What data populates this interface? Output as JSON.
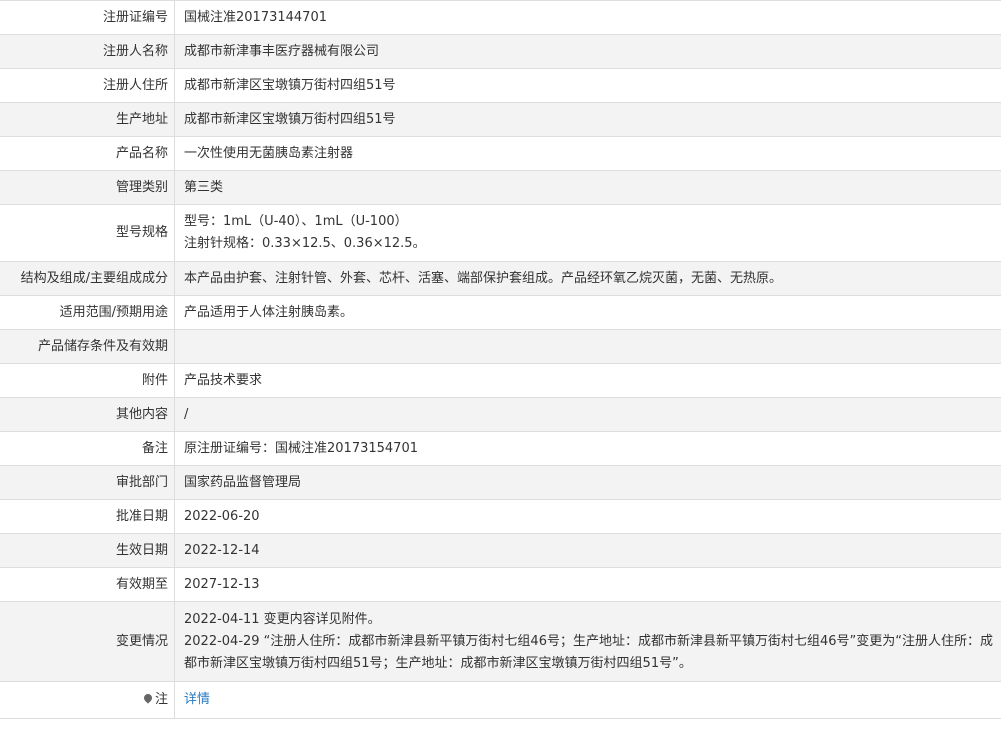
{
  "rows": [
    {
      "label": "注册证编号",
      "value": "国械注准20173144701"
    },
    {
      "label": "注册人名称",
      "value": "成都市新津事丰医疗器械有限公司"
    },
    {
      "label": "注册人住所",
      "value": "成都市新津区宝墩镇万街村四组51号"
    },
    {
      "label": "生产地址",
      "value": "成都市新津区宝墩镇万街村四组51号"
    },
    {
      "label": "产品名称",
      "value": "一次性使用无菌胰岛素注射器"
    },
    {
      "label": "管理类别",
      "value": "第三类"
    },
    {
      "label": "型号规格",
      "lines": [
        "型号：1mL（U-40）、1mL（U-100）",
        "注射针规格：0.33×12.5、0.36×12.5。"
      ]
    },
    {
      "label": "结构及组成/主要组成成分",
      "value": "本产品由护套、注射针管、外套、芯杆、活塞、端部保护套组成。产品经环氧乙烷灭菌，无菌、无热原。"
    },
    {
      "label": "适用范围/预期用途",
      "value": "产品适用于人体注射胰岛素。"
    },
    {
      "label": "产品储存条件及有效期",
      "value": ""
    },
    {
      "label": "附件",
      "value": "产品技术要求"
    },
    {
      "label": "其他内容",
      "value": "/"
    },
    {
      "label": "备注",
      "value": "原注册证编号：国械注准20173154701"
    },
    {
      "label": "审批部门",
      "value": "国家药品监督管理局"
    },
    {
      "label": "批准日期",
      "value": "2022-06-20"
    },
    {
      "label": "生效日期",
      "value": "2022-12-14"
    },
    {
      "label": "有效期至",
      "value": "2027-12-13"
    },
    {
      "label": "变更情况",
      "lines": [
        "2022-04-11 变更内容详见附件。",
        "2022-04-29 “注册人住所：成都市新津县新平镇万街村七组46号；生产地址：成都市新津县新平镇万街村七组46号”变更为“注册人住所：成都市新津区宝墩镇万街村四组51号；生产地址：成都市新津区宝墩镇万街村四组51号”。"
      ]
    },
    {
      "label": "注",
      "value": "详情"
    }
  ]
}
